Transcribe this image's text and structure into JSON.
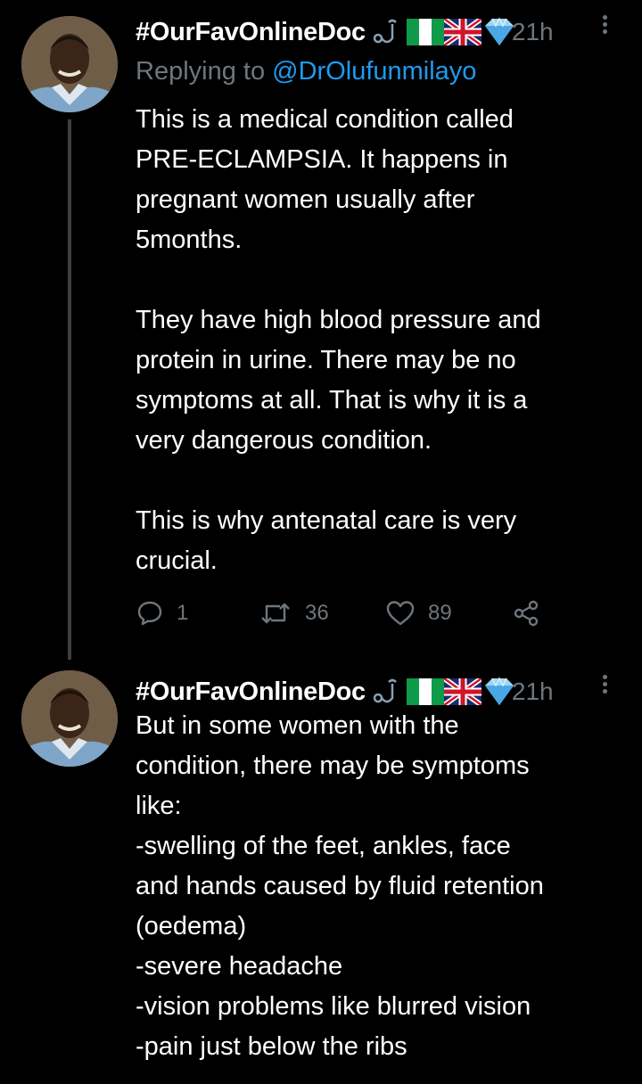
{
  "tweets": [
    {
      "author": "#OurFavOnlineDoc",
      "time": "21h",
      "reply_prefix": "Replying to ",
      "reply_handle": "@DrOlufunmilayo",
      "text": "This is a medical condition called\nPRE-ECLAMPSIA. It happens in\npregnant women usually after\n5months.\n\nThey have high blood pressure and\nprotein in urine. There may be no\nsymptoms at all. That is why it is a\nvery dangerous condition.\n\nThis is why antenatal care is very\ncrucial.",
      "replies": "1",
      "retweets": "36",
      "likes": "89"
    },
    {
      "author": "#OurFavOnlineDoc",
      "time": "21h",
      "text": "But in some women with the\ncondition, there may be symptoms\nlike:\n-swelling of the feet, ankles, face\nand hands caused by fluid retention\n(oedema)\n-severe headache\n-vision problems like blurred vision\n-pain just below the ribs"
    }
  ],
  "name_emojis": [
    "stethoscope-icon",
    "nigeria-flag-icon",
    "uk-flag-icon",
    "gem-icon"
  ],
  "colors": {
    "background": "#000000",
    "text": "#ffffff",
    "muted": "#6e767d",
    "link": "#1d9bf0",
    "thread_line": "#3d3f42"
  }
}
